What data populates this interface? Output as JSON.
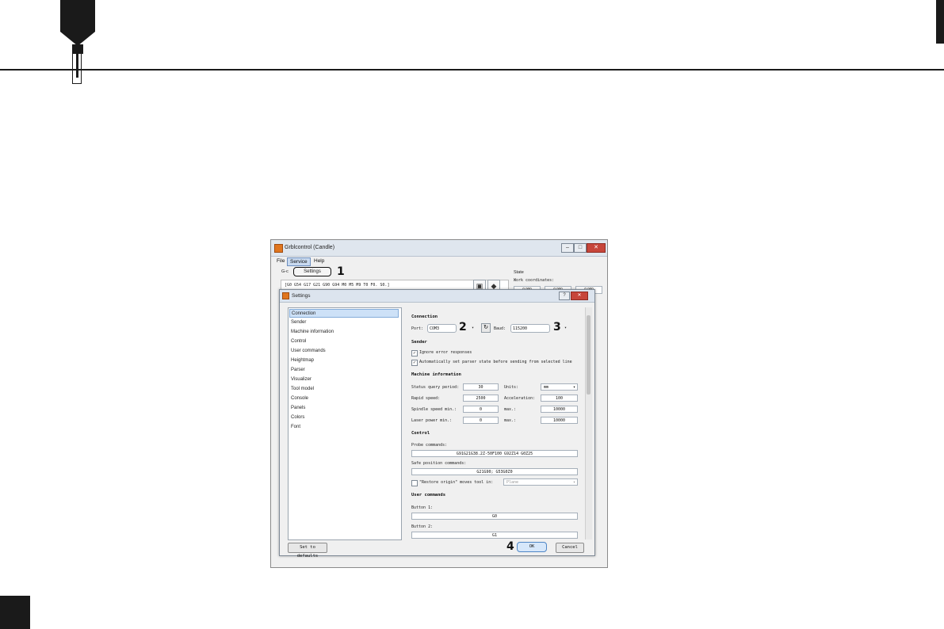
{
  "window": {
    "title": "Grblcontrol (Candle)",
    "controls": {
      "minimize": "–",
      "maximize": "□",
      "close": "✕"
    }
  },
  "menu": {
    "file": "File",
    "service": "Service",
    "help": "Help"
  },
  "service_dropdown": {
    "settings": "Settings"
  },
  "background": {
    "gcode_label": "G-c",
    "gcode_state": "[G0 G54 G17 G21 G90 G94 M0 M5 M9 T0 F0. S0.]",
    "state_label": "State",
    "work_coordinates_label": "Work coordinates:",
    "coords": [
      "0.000",
      "0.000",
      "0.000"
    ]
  },
  "dialog": {
    "title": "Settings",
    "nav": [
      "Connection",
      "Sender",
      "Machine information",
      "Control",
      "User commands",
      "Heightmap",
      "Parser",
      "Visualizer",
      "Tool model",
      "Console",
      "Panels",
      "Colors",
      "Font"
    ],
    "connection": {
      "section": "Connection",
      "port_label": "Port:",
      "port_value": "COM3",
      "baud_label": "Baud:",
      "baud_value": "115200"
    },
    "sender": {
      "section": "Sender",
      "ignore_errors": "Ignore error responses",
      "auto_parser": "Automatically set parser state before sending from selected line"
    },
    "machine": {
      "section": "Machine information",
      "status_label": "Status query period:",
      "status_value": "30",
      "units_label": "Units:",
      "units_value": "mm",
      "rapid_label": "Rapid speed:",
      "rapid_value": "2500",
      "accel_label": "Acceleration:",
      "accel_value": "100",
      "spindle_label": "Spindle speed min.:",
      "spindle_min": "0",
      "spindle_max_label": "max.:",
      "spindle_max": "10000",
      "laser_label": "Laser power min.:",
      "laser_min": "0",
      "laser_max_label": "max.:",
      "laser_max": "10000"
    },
    "control": {
      "section": "Control",
      "probe_label": "Probe commands:",
      "probe_value": "G91G21G38.2Z-50F100 G92Z14 G0Z25",
      "safe_label": "Safe position commands:",
      "safe_value": "G21G90; G53G0Z0",
      "restore_label": "\"Restore origin\" moves tool in:",
      "restore_value": "Plane"
    },
    "user": {
      "section": "User commands",
      "button1_label": "Button 1:",
      "button1_value": "G0",
      "button2_label": "Button 2:",
      "button2_value": "G1"
    },
    "buttons": {
      "defaults": "Set to defaults",
      "ok": "OK",
      "cancel": "Cancel"
    }
  },
  "callouts": {
    "c1": "1",
    "c2": "2",
    "c3": "3",
    "c4": "4"
  },
  "icons": {
    "refresh": "↻",
    "dropdown": "▾",
    "check": "✓"
  }
}
